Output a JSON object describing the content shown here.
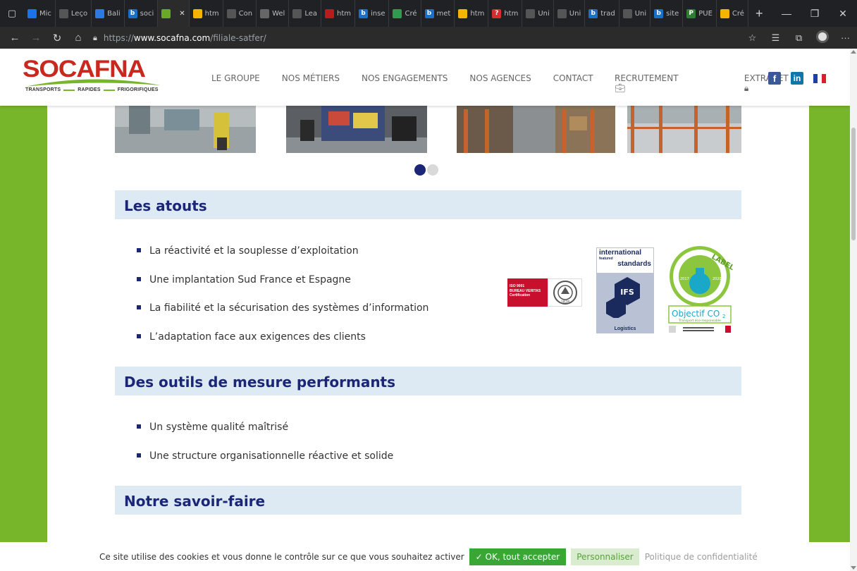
{
  "browser": {
    "tabs": [
      {
        "label": "Mic",
        "fav_color": "#1a73e8",
        "fav_glyph": ""
      },
      {
        "label": "Leço",
        "fav_color": "#555555",
        "fav_glyph": ""
      },
      {
        "label": "Bali",
        "fav_color": "#2a7ae2",
        "fav_glyph": ""
      },
      {
        "label": "soci",
        "fav_color": "#1a6fc9",
        "fav_glyph": "b"
      },
      {
        "label": "",
        "fav_color": "#6aa82a",
        "fav_glyph": ""
      },
      {
        "label": "htm",
        "fav_color": "#f4b400",
        "fav_glyph": ""
      },
      {
        "label": "Con",
        "fav_color": "#555555",
        "fav_glyph": ""
      },
      {
        "label": "Wel",
        "fav_color": "#666666",
        "fav_glyph": ""
      },
      {
        "label": "Lea",
        "fav_color": "#555555",
        "fav_glyph": ""
      },
      {
        "label": "htm",
        "fav_color": "#b71c1c",
        "fav_glyph": ""
      },
      {
        "label": "inse",
        "fav_color": "#1a6fc9",
        "fav_glyph": "b"
      },
      {
        "label": "Cré",
        "fav_color": "#2e9b4e",
        "fav_glyph": ""
      },
      {
        "label": "met",
        "fav_color": "#1a6fc9",
        "fav_glyph": "b"
      },
      {
        "label": "htm",
        "fav_color": "#f4b400",
        "fav_glyph": ""
      },
      {
        "label": "htm",
        "fav_color": "#d32f2f",
        "fav_glyph": "?"
      },
      {
        "label": "Uni",
        "fav_color": "#555555",
        "fav_glyph": ""
      },
      {
        "label": "Uni",
        "fav_color": "#555555",
        "fav_glyph": ""
      },
      {
        "label": "trad",
        "fav_color": "#1a6fc9",
        "fav_glyph": "b"
      },
      {
        "label": "Uni",
        "fav_color": "#555555",
        "fav_glyph": ""
      },
      {
        "label": "site",
        "fav_color": "#1a6fc9",
        "fav_glyph": "b"
      },
      {
        "label": "PUE",
        "fav_color": "#2e7d32",
        "fav_glyph": "P"
      },
      {
        "label": "Cré",
        "fav_color": "#f4b400",
        "fav_glyph": ""
      }
    ],
    "url_prefix": "https://",
    "url_domain": "www.socafna.com",
    "url_path": "/filiale-satfer/"
  },
  "header": {
    "logo_word": "SOCAFNA",
    "logo_tag": [
      "TRANSPORTS",
      "RAPIDES",
      "FRIGORIFIQUES"
    ],
    "nav": [
      "LE GROUPE",
      "NOS MÉTIERS",
      "NOS ENGAGEMENTS",
      "NOS AGENCES",
      "CONTACT"
    ],
    "recrutement": "RECRUTEMENT",
    "extranet": "EXTRANET",
    "social": {
      "facebook": "f",
      "linkedin": "in"
    }
  },
  "gallery": {
    "slide_count": 2,
    "active_index": 0
  },
  "sections": [
    {
      "title": "Les atouts",
      "items": [
        "La réactivité et la souplesse d’exploitation",
        "Une implantation Sud France et Espagne",
        "La fiabilité et la sécurisation des systèmes d’information",
        "L’adaptation face aux exigences des clients"
      ]
    },
    {
      "title": "Des outils de mesure performants",
      "items": [
        "Un système qualité maîtrisé",
        "Une structure organisationnelle réactive et solide"
      ]
    },
    {
      "title": "Notre savoir-faire",
      "items": []
    }
  ],
  "certifications": {
    "bureau_veritas": {
      "line1": "ISO 9001",
      "line2": "BUREAU VERITAS",
      "line3": "Certification",
      "seal_year": "1828"
    },
    "ifs": {
      "line1": "international",
      "line2": "featured",
      "line3": "standards",
      "hex": "IFS",
      "caption": "Logistics"
    },
    "co2": {
      "label": "LABEL",
      "year_left": "2017",
      "year_right": "2020",
      "title": "Objectif CO",
      "title_sub": "2",
      "subtitle": "Transport éco-responsable"
    }
  },
  "cookie": {
    "text": "Ce site utilise des cookies et vous donne le contrôle sur ce que vous souhaitez activer",
    "accept": "✓ OK, tout accepter",
    "customize": "Personnaliser",
    "policy": "Politique de confidentialité"
  },
  "colors": {
    "brand_red": "#c8281e",
    "brand_green": "#77b52b",
    "heading_blue": "#1b2677",
    "section_bg": "#dde9f3"
  }
}
